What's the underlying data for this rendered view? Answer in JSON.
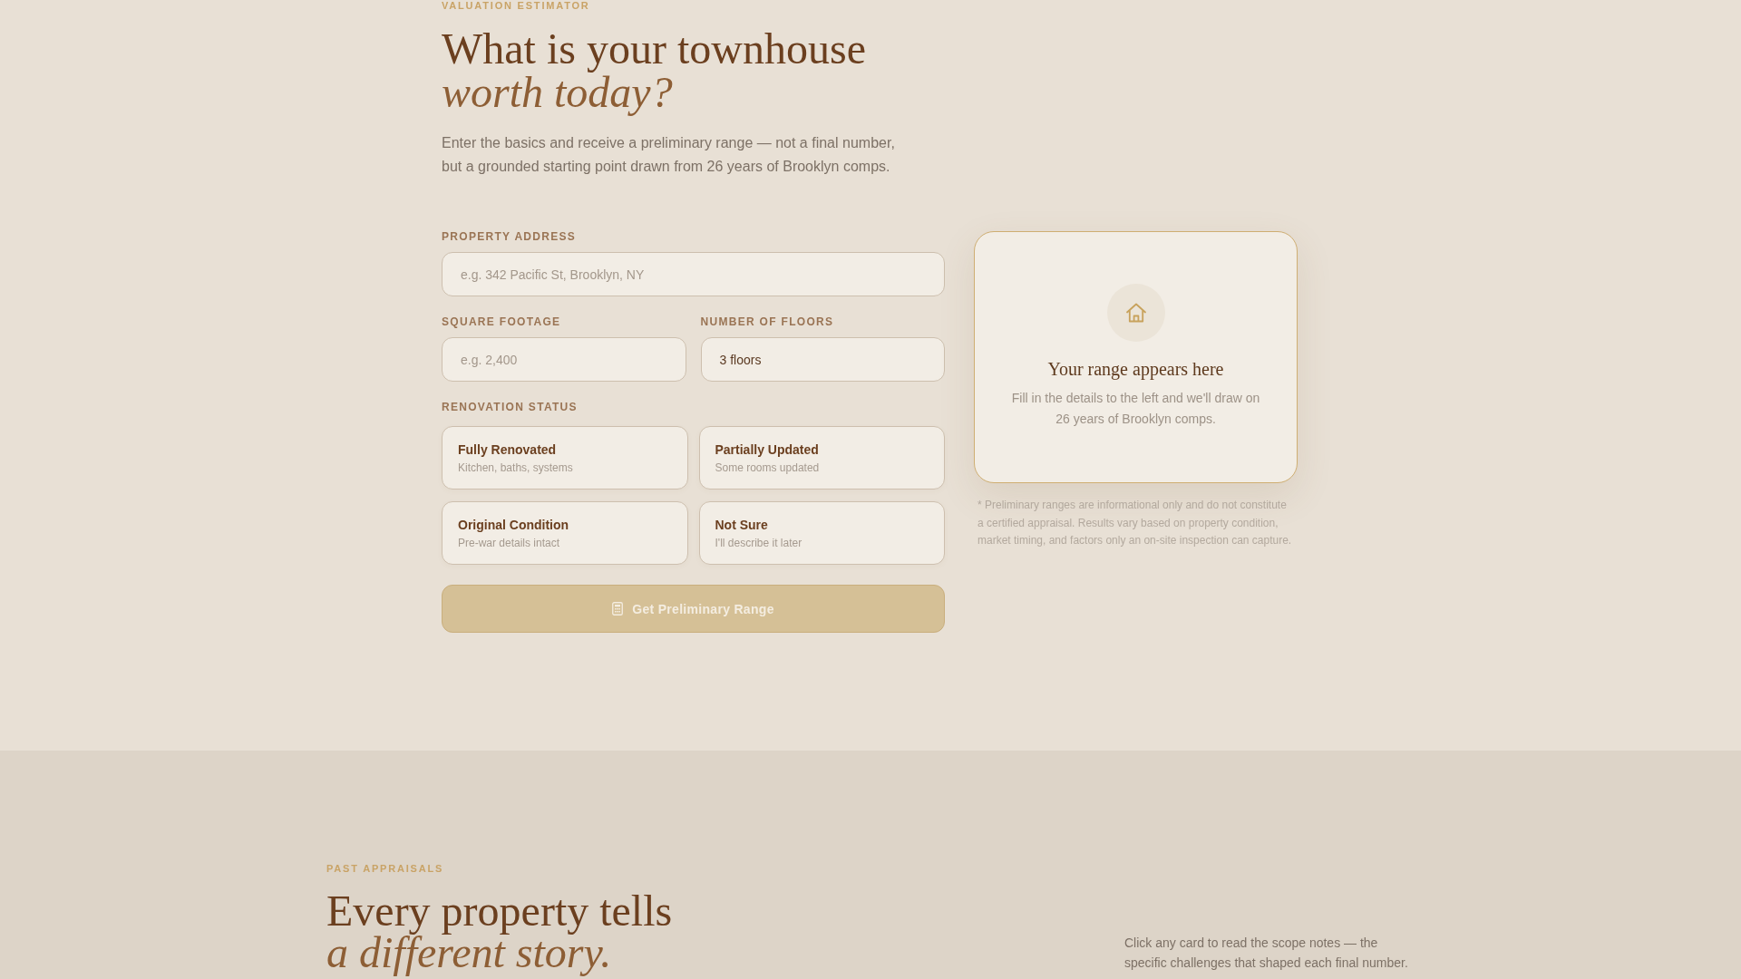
{
  "estimator": {
    "eyebrow": "VALUATION ESTIMATOR",
    "title": "What is your townhouse *worth today?*",
    "intro": "Enter the basics and receive a preliminary range — not a final number, but a grounded starting point drawn from 26 years of Brooklyn comps."
  },
  "form": {
    "property_address": {
      "label": "PROPERTY ADDRESS",
      "placeholder": "e.g. 342 Pacific St, Brooklyn, NY"
    },
    "square_footage": {
      "label": "SQUARE FOOTAGE",
      "placeholder": "e.g. 2,400"
    },
    "number_of_floors": {
      "label": "NUMBER OF FLOORS",
      "value": "3 floors"
    },
    "renovation": {
      "label": "RENOVATION STATUS",
      "options": [
        {
          "title": "Fully Renovated",
          "subtitle": "Kitchen, baths, systems",
          "selected": false
        },
        {
          "title": "Partially Updated",
          "subtitle": "Some rooms updated",
          "selected": false
        },
        {
          "title": "Original Condition",
          "subtitle": "Pre-war details intact",
          "selected": false
        },
        {
          "title": "Not Sure",
          "subtitle": "I'll describe it later",
          "selected": false
        }
      ]
    },
    "submit": {
      "label": "Get Preliminary Range",
      "disabled": true
    }
  },
  "result": {
    "title": "Your range appears here",
    "text": "Fill in the details to the left and we'll draw on 26 years of Brooklyn comps.",
    "disclaimer": "* Preliminary ranges are informational only and do not constitute a certified appraisal. Results vary based on property condition, market timing, and factors only an on-site inspection can capture."
  },
  "past_appraisals": {
    "eyebrow": "PAST APPRAISALS",
    "title": "Every property tells *a different story.*",
    "note": "Click any card to read the scope notes — the specific challenges that shaped each final number."
  }
}
